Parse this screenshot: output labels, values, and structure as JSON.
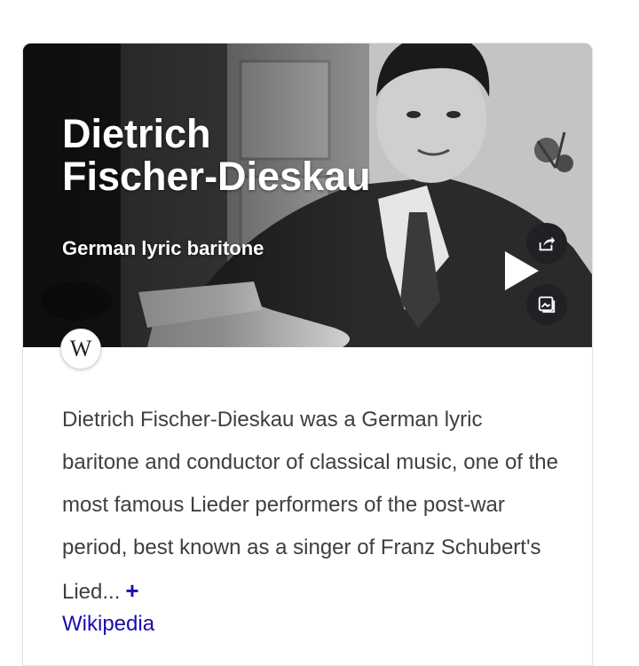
{
  "knowledge_panel": {
    "title_line1": "Dietrich",
    "title_line2": "Fischer-Dieskau",
    "subtitle": "German lyric baritone",
    "actions": {
      "share_icon": "share-icon",
      "images_icon": "images-icon",
      "play_icon": "play-icon"
    },
    "source_badge": "W",
    "description": "Dietrich Fischer-Dieskau was a German lyric baritone and conductor of classical music, one of the most famous Lieder performers of the post-war period, best known as a singer of Franz Schubert's Lied...",
    "more_label": "+",
    "source_link": "Wikipedia"
  },
  "colors": {
    "link": "#1a0dab",
    "body_text": "#3c4043",
    "button_bg": "#202124"
  }
}
